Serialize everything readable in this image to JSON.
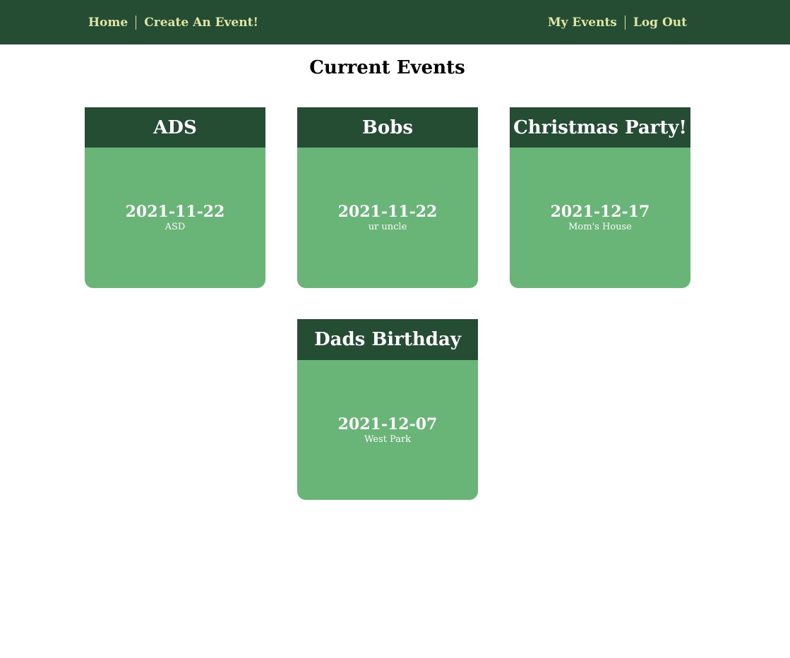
{
  "nav": {
    "left": [
      "Home",
      "Create An Event!"
    ],
    "right": [
      "My Events",
      "Log Out"
    ]
  },
  "page": {
    "title": "Current Events"
  },
  "events": [
    {
      "title": "ADS",
      "date": "2021-11-22",
      "location": "ASD"
    },
    {
      "title": "Bobs",
      "date": "2021-11-22",
      "location": "ur uncle"
    },
    {
      "title": "Christmas Party!",
      "date": "2021-12-17",
      "location": "Mom's House"
    },
    {
      "title": "Dads Birthday",
      "date": "2021-12-07",
      "location": "West Park"
    }
  ],
  "colors": {
    "nav_background": "#244d33",
    "nav_link": "#dfe6a3",
    "card_header": "#244d33",
    "card_body": "#69b577",
    "card_text": "#ffffff"
  }
}
